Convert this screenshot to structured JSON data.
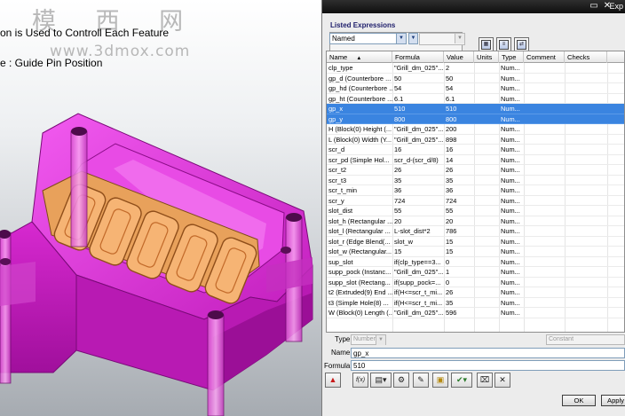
{
  "viewport": {
    "watermark_cn": "模 西 网",
    "watermark_url": "www.3dmox.com",
    "caption_line1": "on is Used to Controll Each Feature",
    "caption_line2": "e : Guide Pin Position"
  },
  "dialog": {
    "title": "Exp",
    "listed_label": "Listed Expressions",
    "filter_value": "Named",
    "columns": [
      "Name",
      "Formula",
      "Value",
      "Units",
      "Type",
      "Comment",
      "Checks"
    ],
    "sort_indicator": "▲",
    "rows": [
      {
        "name": "clp_type",
        "formula": "\"Grill_dm_025\"...",
        "value": "2",
        "units": "",
        "type": "Num..."
      },
      {
        "name": "gp_d  (Counterbore ...",
        "formula": "50",
        "value": "50",
        "units": "",
        "type": "Num..."
      },
      {
        "name": "gp_hd  (Counterbore ...",
        "formula": "54",
        "value": "54",
        "units": "",
        "type": "Num..."
      },
      {
        "name": "gp_ht  (Counterbore ...",
        "formula": "6.1",
        "value": "6.1",
        "units": "",
        "type": "Num..."
      },
      {
        "name": "gp_x",
        "formula": "510",
        "value": "510",
        "units": "",
        "type": "Num...",
        "selected": true
      },
      {
        "name": "gp_y",
        "formula": "800",
        "value": "800",
        "units": "",
        "type": "Num...",
        "selected": true
      },
      {
        "name": "H  (Block(0) Height (...",
        "formula": "\"Grill_dm_025\"...",
        "value": "200",
        "units": "",
        "type": "Num..."
      },
      {
        "name": "L  (Block(0) Width (Y...",
        "formula": "\"Grill_dm_025\"...",
        "value": "898",
        "units": "",
        "type": "Num..."
      },
      {
        "name": "scr_d",
        "formula": "16",
        "value": "16",
        "units": "",
        "type": "Num..."
      },
      {
        "name": "scr_pd  (Simple Hol...",
        "formula": "scr_d-(scr_d/8)",
        "value": "14",
        "units": "",
        "type": "Num..."
      },
      {
        "name": "scr_t2",
        "formula": "26",
        "value": "26",
        "units": "",
        "type": "Num..."
      },
      {
        "name": "scr_t3",
        "formula": "35",
        "value": "35",
        "units": "",
        "type": "Num..."
      },
      {
        "name": "scr_t_min",
        "formula": "36",
        "value": "36",
        "units": "",
        "type": "Num..."
      },
      {
        "name": "scr_y",
        "formula": "724",
        "value": "724",
        "units": "",
        "type": "Num..."
      },
      {
        "name": "slot_dist",
        "formula": "55",
        "value": "55",
        "units": "",
        "type": "Num..."
      },
      {
        "name": "slot_h  (Rectangular ...",
        "formula": "20",
        "value": "20",
        "units": "",
        "type": "Num..."
      },
      {
        "name": "slot_l  (Rectangular ...",
        "formula": "L-slot_dist*2",
        "value": "786",
        "units": "",
        "type": "Num..."
      },
      {
        "name": "slot_r  (Edge Blend(...",
        "formula": "slot_w",
        "value": "15",
        "units": "",
        "type": "Num..."
      },
      {
        "name": "slot_w  (Rectangular...",
        "formula": "15",
        "value": "15",
        "units": "",
        "type": "Num..."
      },
      {
        "name": "sup_slot",
        "formula": "if(clp_type==3...",
        "value": "0",
        "units": "",
        "type": "Num..."
      },
      {
        "name": "supp_pock  (Instanc...",
        "formula": "\"Grill_dm_025\"...",
        "value": "1",
        "units": "",
        "type": "Num..."
      },
      {
        "name": "supp_slot  (Rectang...",
        "formula": "if(supp_pock=...",
        "value": "0",
        "units": "",
        "type": "Num..."
      },
      {
        "name": "t2  (Extruded(9) End ...",
        "formula": "if(H<=scr_t_mi...",
        "value": "26",
        "units": "",
        "type": "Num..."
      },
      {
        "name": "t3  (Simple Hole(8) ...",
        "formula": "if(H<=scr_t_mi...",
        "value": "35",
        "units": "",
        "type": "Num..."
      },
      {
        "name": "W  (Block(0) Length (...",
        "formula": "\"Grill_dm_025\"...",
        "value": "596",
        "units": "",
        "type": "Num..."
      }
    ],
    "type_label": "Type",
    "type_value": "Number",
    "constant_value": "Constant",
    "name_label": "Name",
    "name_value": "gp_x",
    "formula_label": "Formula",
    "formula_value": "510",
    "fx_label": "f(x)",
    "ok_label": "OK",
    "apply_label": "Apply"
  }
}
